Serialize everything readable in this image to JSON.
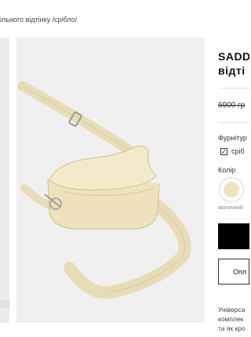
{
  "breadcrumb": {
    "text": "ільного відтінку /срібло/"
  },
  "product": {
    "title_line1": "SADD",
    "title_line2": "відті",
    "old_price": "6900 гр",
    "accessories_label": "Фурнітур",
    "accessories_option": "сріб",
    "color_label": "Колір",
    "color_swatch_label": "молочний",
    "color_swatch_hex": "#efe3c0",
    "pay_button_label": "Опл",
    "description": [
      "Універса",
      "комплек",
      "та як кро"
    ]
  }
}
